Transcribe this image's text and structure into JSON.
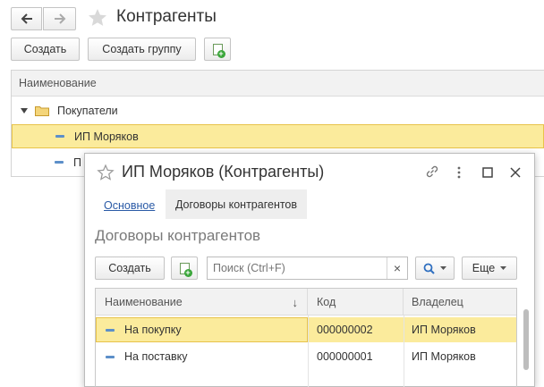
{
  "main": {
    "title": "Контрагенты",
    "nav": {
      "back_icon": "arrow-left-icon",
      "forward_icon": "arrow-right-icon",
      "star_icon": "star-icon"
    },
    "toolbar": {
      "create_label": "Создать",
      "create_group_label": "Создать группу",
      "add_copy_icon": "add-document-icon"
    },
    "list": {
      "header": "Наименование",
      "group": {
        "label": "Покупатели"
      },
      "items": [
        {
          "label": "ИП Моряков",
          "selected": true
        },
        {
          "label": "П",
          "selected": false
        }
      ]
    }
  },
  "dialog": {
    "title": "ИП Моряков (Контрагенты)",
    "tabs": [
      {
        "label": "Основное"
      },
      {
        "label": "Договоры контрагентов"
      }
    ],
    "section_title": "Договоры контрагентов",
    "toolbar": {
      "create_label": "Создать",
      "search_placeholder": "Поиск (Ctrl+F)",
      "clear_symbol": "×",
      "more_label": "Еще"
    },
    "table": {
      "columns": [
        {
          "label": "Наименование",
          "sort_mark": "↓"
        },
        {
          "label": "Код"
        },
        {
          "label": "Владелец"
        }
      ],
      "rows": [
        {
          "name": "На покупку",
          "code": "000000002",
          "owner": "ИП Моряков",
          "selected": true
        },
        {
          "name": "На поставку",
          "code": "000000001",
          "owner": "ИП Моряков",
          "selected": false
        }
      ]
    }
  },
  "colors": {
    "selection": "#fbeb9c",
    "selection_border": "#e8c34a",
    "link": "#2a5aa6",
    "header_bg": "#f2f2f2"
  }
}
